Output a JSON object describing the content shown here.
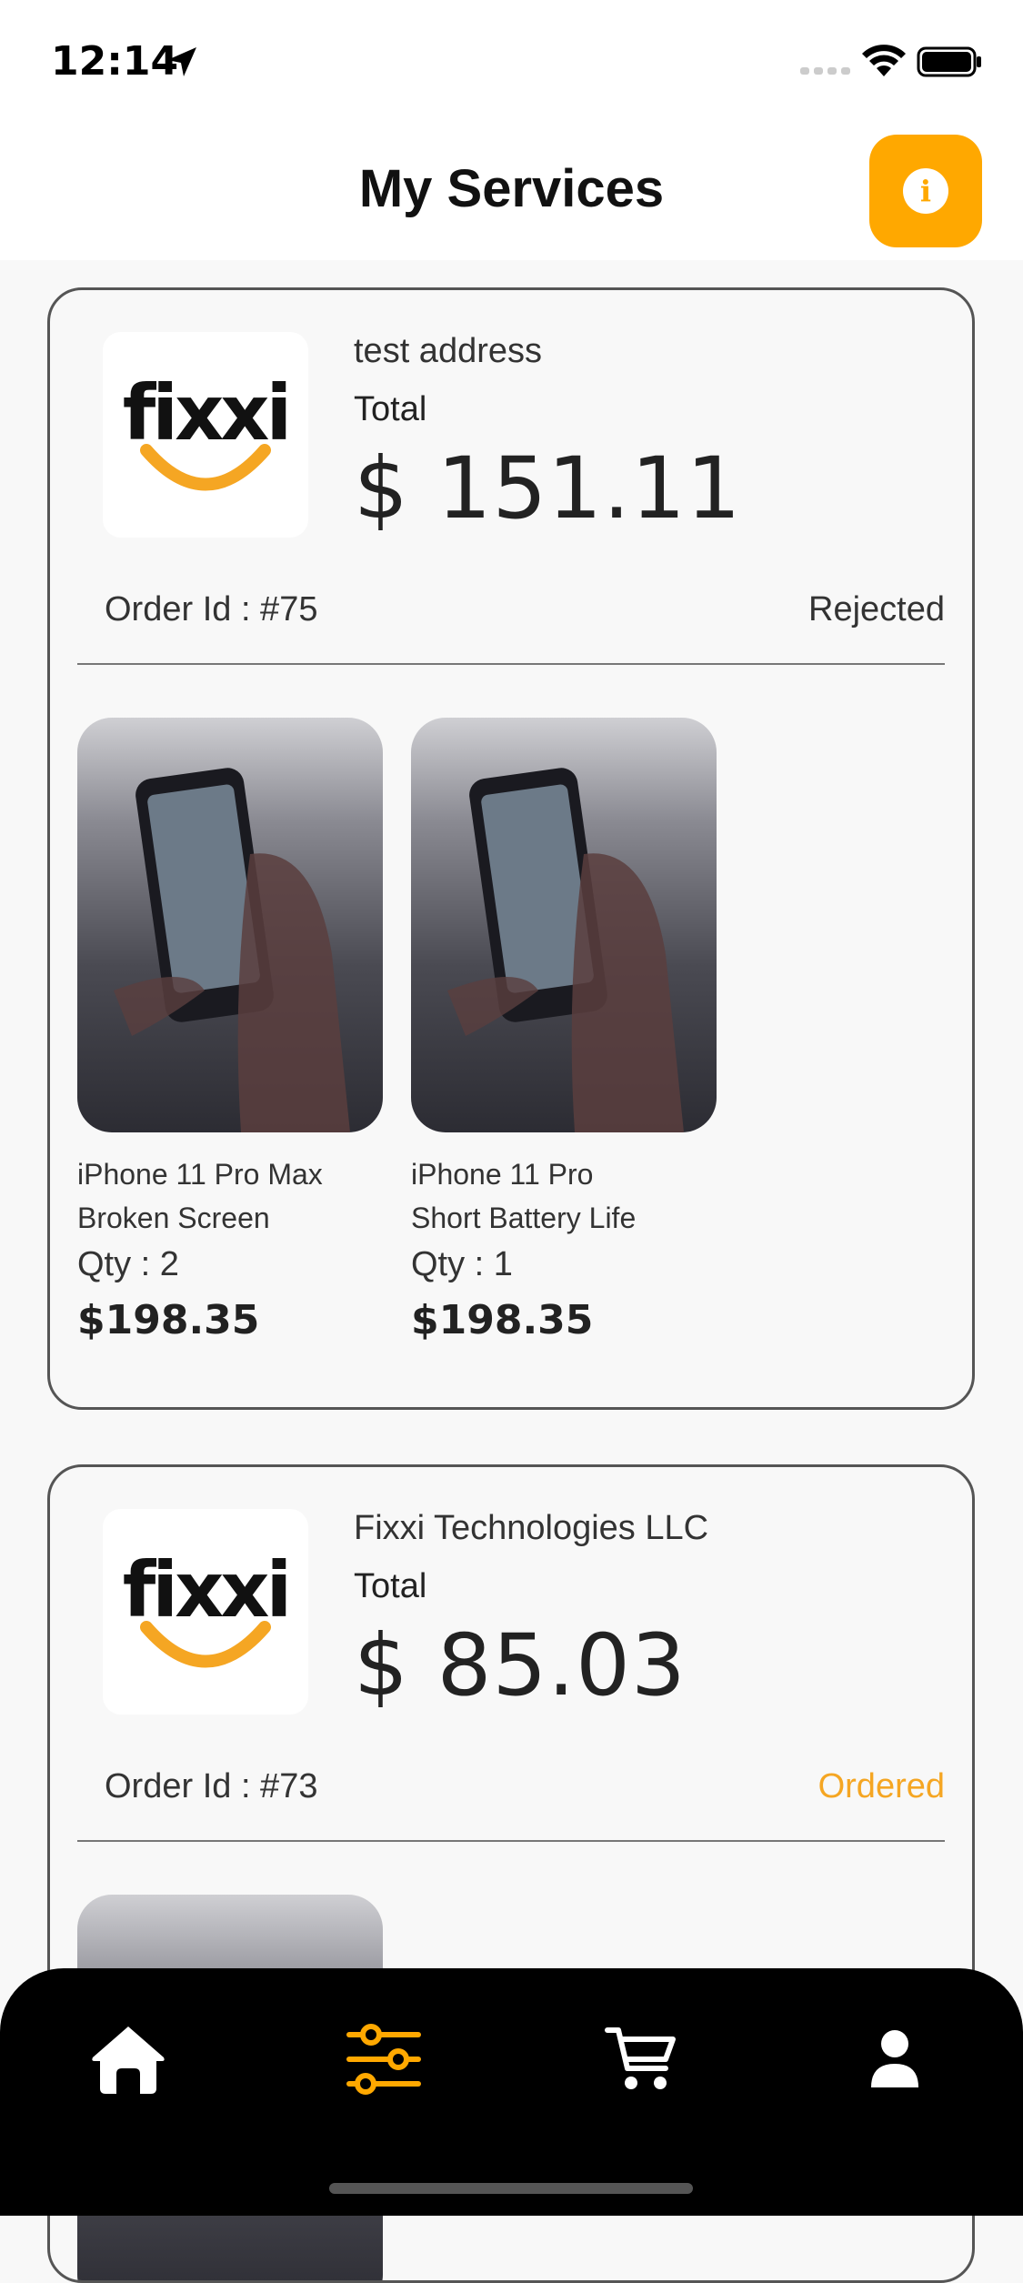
{
  "status_bar": {
    "time": "12:14"
  },
  "header": {
    "title": "My Services",
    "info_label": "i"
  },
  "orders": [
    {
      "store": "test address",
      "total_label": "Total",
      "total_amount": "$ 151.11",
      "order_id": "Order Id : #75",
      "status": "Rejected",
      "items": [
        {
          "name_line1": "iPhone 11 Pro Max",
          "name_line2": "Broken Screen",
          "qty": "Qty : 2",
          "price": "$198.35"
        },
        {
          "name_line1": "iPhone 11 Pro",
          "name_line2": "Short Battery Life",
          "qty": "Qty : 1",
          "price": "$198.35"
        }
      ]
    },
    {
      "store": "Fixxi Technologies LLC",
      "total_label": "Total",
      "total_amount": "$ 85.03",
      "order_id": "Order Id : #73",
      "status": "Ordered",
      "items": []
    }
  ],
  "logo_text": "fixxi",
  "colors": {
    "accent": "#FFA800",
    "ordered": "#F5A623",
    "nav_bg": "#000000"
  },
  "nav": [
    {
      "icon": "home-icon"
    },
    {
      "icon": "sliders-icon",
      "active": true
    },
    {
      "icon": "cart-icon"
    },
    {
      "icon": "user-icon"
    }
  ]
}
